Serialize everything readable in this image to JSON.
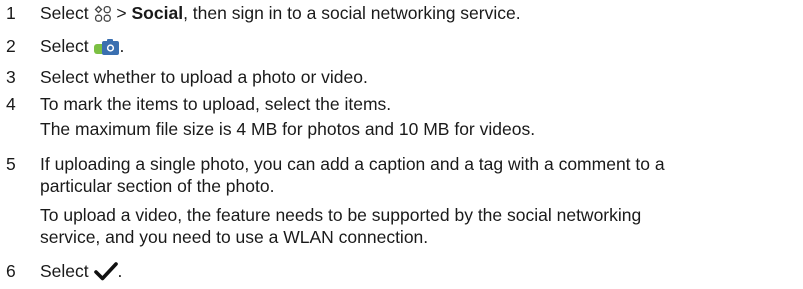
{
  "steps": [
    {
      "num": "1",
      "before": "Select",
      "menu_sep": ">",
      "menu_item": "Social",
      "after": ", then sign in to a social networking service."
    },
    {
      "num": "2",
      "before": "Select",
      "after": "."
    },
    {
      "num": "3",
      "text": "Select whether to upload a photo or video."
    },
    {
      "num": "4",
      "text": "To mark the items to upload, select the items.",
      "note": "The maximum file size is 4 MB for photos and 10 MB for videos."
    },
    {
      "num": "5",
      "line1": "If uploading a single photo, you can add a caption and a tag with a comment to a",
      "line2": "particular section of the photo.",
      "note_line1": "To upload a video, the feature needs to be supported by the social networking",
      "note_line2": "service, and you need to use a WLAN connection."
    },
    {
      "num": "6",
      "before": "Select",
      "after": "."
    }
  ],
  "icons": {
    "menu": "menu-grid-icon",
    "upload": "camera-upload-icon",
    "confirm": "checkmark-icon"
  },
  "colors": {
    "text": "#1a1a1a",
    "upload_green": "#7cc043",
    "upload_blue": "#3a6fb0"
  }
}
